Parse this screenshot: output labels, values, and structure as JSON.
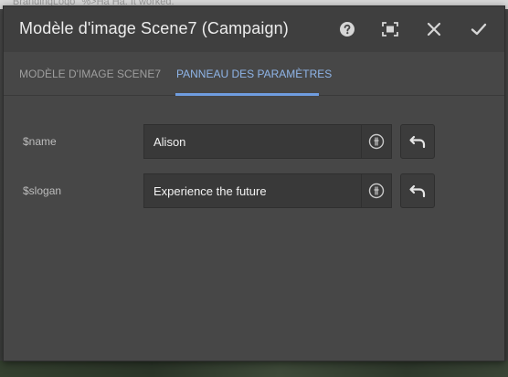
{
  "background": {
    "snippet": "\"BrandingLogo\" %>Ha Ha. It worked."
  },
  "dialog": {
    "title": "Modèle d'image Scene7 (Campaign)",
    "toolbar": {
      "help_icon": "help-circle-icon",
      "fullscreen_icon": "fullscreen-icon",
      "close_icon": "close-icon",
      "confirm_icon": "checkmark-icon"
    },
    "tabs": [
      {
        "label": "MODÈLE D'IMAGE SCENE7",
        "active": false
      },
      {
        "label": "PANNEAU DES PARAMÈTRES",
        "active": true
      }
    ],
    "params": [
      {
        "label": "$name",
        "value": "Alison",
        "picker_icon": "asset-picker-icon",
        "reset_icon": "undo-icon"
      },
      {
        "label": "$slogan",
        "value": "Experience the future",
        "picker_icon": "asset-picker-icon",
        "reset_icon": "undo-icon"
      }
    ]
  },
  "colors": {
    "accent": "#8fb5e8",
    "accent_underline": "#6f9de0",
    "dialog_bg": "#474747",
    "titlebar_bg": "#3f3f3f",
    "field_bg": "#393939"
  }
}
